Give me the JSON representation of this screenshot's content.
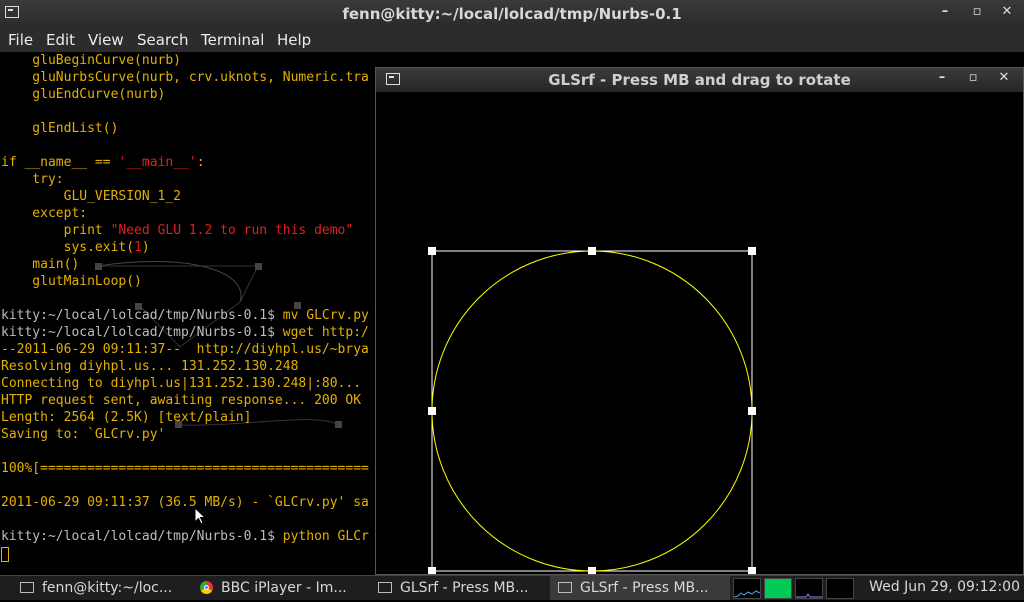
{
  "terminal": {
    "title": "fenn@kitty:~/local/lolcad/tmp/Nurbs-0.1",
    "menu": [
      "File",
      "Edit",
      "View",
      "Search",
      "Terminal",
      "Help"
    ],
    "lines": [
      "    gluBeginCurve(nurb)",
      "    gluNurbsCurve(nurb, crv.uknots, Numeric.tra",
      "    gluEndCurve(nurb)",
      "",
      "    glEndList()",
      "",
      "if __name__ == '__main__':",
      "    try:",
      "        GLU_VERSION_1_2",
      "    except:",
      "        print \"Need GLU 1.2 to run this demo\"",
      "        sys.exit(1)",
      "    main()",
      "    glutMainLoop()",
      "",
      "kitty:~/local/lolcad/tmp/Nurbs-0.1$ mv GLCrv.py",
      "kitty:~/local/lolcad/tmp/Nurbs-0.1$ wget http:/",
      "--2011-06-29 09:11:37--  http://diyhpl.us/~brya",
      "Resolving diyhpl.us... 131.252.130.248",
      "Connecting to diyhpl.us|131.252.130.248|:80...",
      "HTTP request sent, awaiting response... 200 OK",
      "Length: 2564 (2.5K) [text/plain]",
      "Saving to: `GLCrv.py'",
      "",
      "100%[==========================================",
      "",
      "2011-06-29 09:11:37 (36.5 MB/s) - `GLCrv.py' sa",
      "",
      "kitty:~/local/lolcad/tmp/Nurbs-0.1$ python GLCr"
    ],
    "string_parts": {
      "main_str": "'__main__'",
      "main_prefix": "if __name__ == ",
      "main_suffix": ":",
      "print_prefix": "        print ",
      "print_str": "\"Need GLU 1.2 to run this demo\"",
      "exit_prefix": "        sys.exit(",
      "exit_num": "1",
      "exit_suffix": ")",
      "prompt": "kitty:~/local/lolcad/tmp/Nurbs-0.1$ ",
      "cmd1": "mv GLCrv.py",
      "cmd2": "wget http:/",
      "cmd3": "python GLCr"
    }
  },
  "gl_window": {
    "title": "GLSrf - Press MB and drag to rotate",
    "curve_color": "#ffff00",
    "hull_color": "#ffffff"
  },
  "window_buttons": {
    "minimize": "–",
    "maximize": "▫",
    "close": "✕"
  },
  "taskbar": {
    "tasks": [
      "fenn@kitty:~/loc...",
      "BBC iPlayer - Im...",
      "GLSrf - Press MB...",
      "GLSrf - Press MB..."
    ],
    "clock": "Wed Jun 29, 09:12:00"
  }
}
